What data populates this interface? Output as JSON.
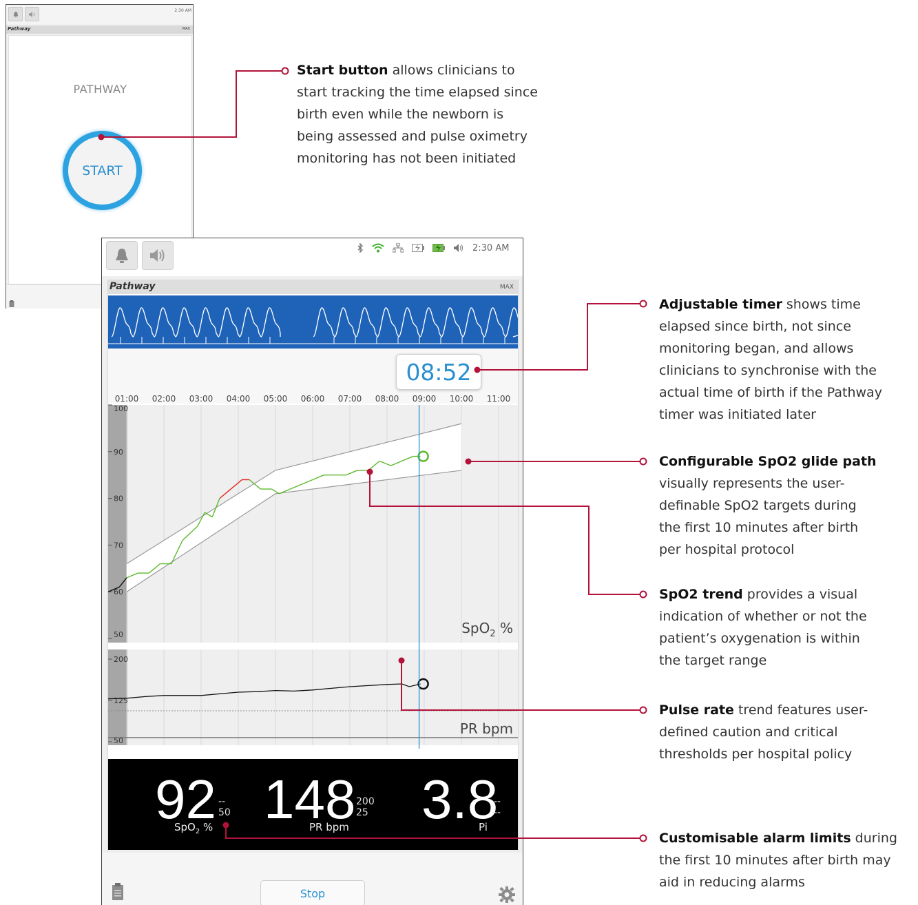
{
  "small_screen": {
    "status_time": "2:30 AM",
    "header_title": "Pathway",
    "header_max": "MAX",
    "pathway_label": "PATHWAY",
    "start_label": "START"
  },
  "main_screen": {
    "status_time": "2:30 AM",
    "header_title": "Pathway",
    "header_max": "MAX",
    "timer": "08:52",
    "time_ticks": [
      "01:00",
      "02:00",
      "03:00",
      "04:00",
      "05:00",
      "06:00",
      "07:00",
      "08:00",
      "09:00",
      "10:00",
      "11:00"
    ],
    "spo2_axis": [
      "100",
      "90",
      "80",
      "70",
      "60",
      "50"
    ],
    "spo2_label": "SpO",
    "spo2_label_sub": "2",
    "spo2_label_unit": " %",
    "pr_axis": [
      "200",
      "125",
      "50"
    ],
    "pr_label": "PR bpm",
    "spo2_value": "92",
    "spo2_limit_high": "--",
    "spo2_limit_low": "50",
    "spo2_num_label": "SpO",
    "spo2_num_label_sub": "2",
    "spo2_num_label_unit": " %",
    "pr_value": "148",
    "pr_limit_high": "200",
    "pr_limit_low": "25",
    "pr_num_label": "PR bpm",
    "pi_value": "3.8",
    "pi_limit_high": "--",
    "pi_limit_low": "--",
    "pi_num_label": "Pi",
    "stop_label": "Stop"
  },
  "annotations": {
    "start": {
      "bold": "Start button",
      "lines": [
        " allows clinicians to",
        "start tracking the time elapsed since",
        "birth even while the newborn is",
        "being assessed and pulse oximetry",
        "monitoring has not been initiated"
      ]
    },
    "timer": {
      "bold": "Adjustable timer",
      "lines": [
        " shows time",
        "elapsed since birth, not since",
        "monitoring began, and allows",
        "clinicians to synchronise with the",
        "actual time of birth if the Pathway",
        "timer was initiated later"
      ]
    },
    "glide": {
      "bold": "Configurable SpO2 glide path",
      "lines": [
        "",
        "visually represents the user-",
        "definable SpO2 targets during",
        "the first 10 minutes after birth",
        "per hospital protocol"
      ]
    },
    "trend": {
      "bold": "SpO2 trend",
      "lines": [
        " provides a visual",
        "indication of whether or not the",
        "patient’s oxygenation is within",
        "the target range"
      ]
    },
    "pulse": {
      "bold": "Pulse rate",
      "lines": [
        " trend features user-",
        "defined caution and critical",
        "thresholds per hospital policy"
      ]
    },
    "alarm": {
      "bold": "Customisable alarm limits",
      "lines": [
        " during",
        "the first 10 minutes after birth may",
        "aid in reducing alarms"
      ]
    }
  },
  "colors": {
    "accent_blue": "#2a8fd0",
    "pleth_bg": "#1f63b9",
    "callout_red": "#b3123a",
    "trend_green": "#5cb82a",
    "trend_red": "#e0251b"
  },
  "chart_data": [
    {
      "type": "line",
      "xlabel": "",
      "ylabel": "SpO2 %",
      "ylim": [
        50,
        100
      ],
      "x_ticks": [
        "01:00",
        "02:00",
        "03:00",
        "04:00",
        "05:00",
        "06:00",
        "07:00",
        "08:00",
        "09:00",
        "10:00",
        "11:00"
      ],
      "series": [
        {
          "values": [
            [
              0.5,
              60
            ],
            [
              0.8,
              61
            ],
            [
              1.0,
              63
            ],
            [
              1.3,
              64
            ],
            [
              1.6,
              64
            ],
            [
              1.9,
              66
            ],
            [
              2.2,
              66
            ],
            [
              2.5,
              71
            ],
            [
              2.9,
              74
            ],
            [
              3.1,
              77
            ],
            [
              3.3,
              76
            ],
            [
              3.5,
              80
            ],
            [
              3.8,
              82
            ],
            [
              4.1,
              84
            ],
            [
              4.3,
              84
            ],
            [
              4.6,
              82
            ],
            [
              4.9,
              82
            ],
            [
              5.1,
              81
            ],
            [
              5.4,
              82
            ],
            [
              5.7,
              83
            ],
            [
              6.0,
              84
            ],
            [
              6.3,
              85
            ],
            [
              6.6,
              85
            ],
            [
              6.9,
              85
            ],
            [
              7.2,
              86
            ],
            [
              7.5,
              86
            ],
            [
              7.8,
              88
            ],
            [
              8.1,
              87
            ],
            [
              8.4,
              88
            ],
            [
              8.7,
              89
            ],
            [
              8.9,
              89
            ]
          ]
        }
      ],
      "glide_path_upper": [
        [
          1,
          66
        ],
        [
          5,
          86
        ],
        [
          10,
          96
        ]
      ],
      "glide_path_lower": [
        [
          1,
          60
        ],
        [
          5,
          81
        ],
        [
          10,
          86
        ]
      ],
      "current_marker_time": "08:52"
    },
    {
      "type": "line",
      "xlabel": "",
      "ylabel": "PR bpm",
      "ylim": [
        50,
        200
      ],
      "series": [
        {
          "values": [
            [
              0.5,
              128
            ],
            [
              1.0,
              129
            ],
            [
              1.5,
              132
            ],
            [
              2.0,
              134
            ],
            [
              2.5,
              134
            ],
            [
              3.0,
              134
            ],
            [
              3.5,
              137
            ],
            [
              4.0,
              140
            ],
            [
              4.5,
              141
            ],
            [
              5.0,
              143
            ],
            [
              5.5,
              142
            ],
            [
              6.0,
              144
            ],
            [
              6.5,
              147
            ],
            [
              7.0,
              150
            ],
            [
              7.5,
              152
            ],
            [
              8.0,
              154
            ],
            [
              8.4,
              155
            ],
            [
              8.6,
              150
            ],
            [
              8.9,
              155
            ]
          ]
        }
      ],
      "caution_threshold": 115
    }
  ]
}
